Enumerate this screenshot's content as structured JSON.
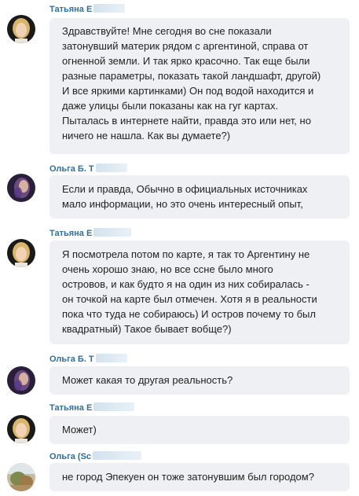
{
  "messages": [
    {
      "sender": "Татьяна Е",
      "avatar": "avatar-blonde-woman",
      "text": "Здравствуйте! Мне сегодня во сне показали\nзатонувший материк рядом с аргентиной, справа от\nогненной земли. И так ярко красочно. Так еще были\nразные параметры, показать такой ландшафт, другой)\nИ все яркими картинками) Он под водой находится и\nдаже улицы были показаны как на гуг картах.\nПыталась в интернете найти, правда это или нет, но\nничего не нашла. Как вы думаете?)"
    },
    {
      "sender": "Ольга Б. Т",
      "avatar": "avatar-purple-glow",
      "text": "Если и правда, Обычно в официальных источниках\nмало информации, но это очень интересный опыт,"
    },
    {
      "sender": "Татьяна Е",
      "avatar": "avatar-blonde-woman",
      "text": "Я посмотрела потом по карте, я так то Аргентину не\nочень хорошо знаю, но все ссне было много\nостровов, и как будто я на один из них  собиралась -\nон точкой на карте был отмечен. Хотя я в реальности\nпока что туда не собираюсь) И остров почему то был\nквадратный) Такое бывает вобще?)"
    },
    {
      "sender": "Ольга Б. Т",
      "avatar": "avatar-purple-glow",
      "text": " Может какая то другая реальность?"
    },
    {
      "sender": "Татьяна Е",
      "avatar": "avatar-blonde-woman",
      "text": "Может)"
    },
    {
      "sender": "Ольга (Sc",
      "avatar": "avatar-landscape",
      "text": "не город Эпекуен он тоже затонувшим был городом?"
    }
  ]
}
